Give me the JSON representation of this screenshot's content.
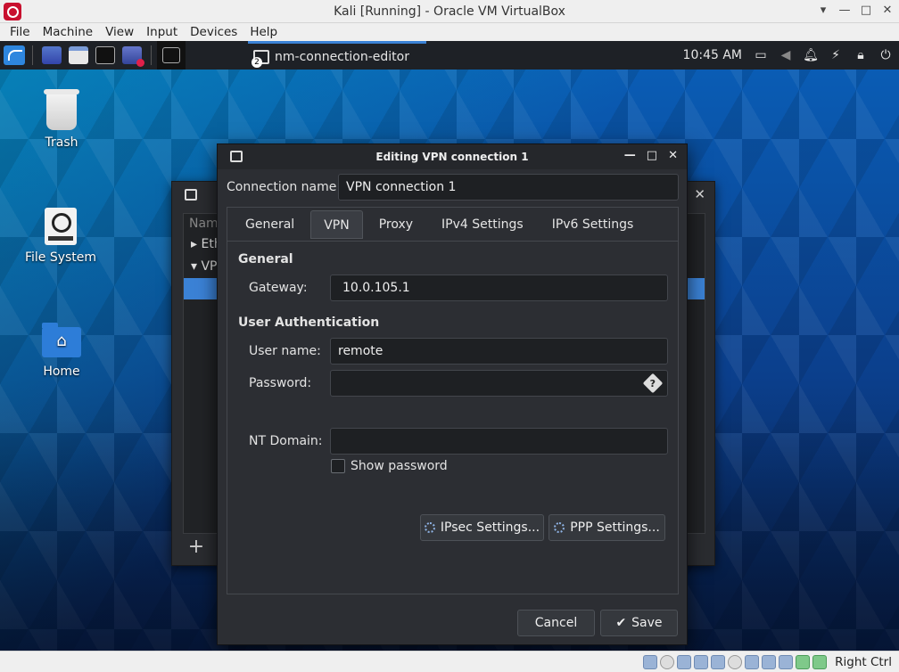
{
  "host": {
    "title": "Kali [Running] - Oracle VM VirtualBox",
    "menu": [
      "File",
      "Machine",
      "View",
      "Input",
      "Devices",
      "Help"
    ],
    "window_controls": [
      "▾",
      "—",
      "□",
      "✕"
    ],
    "status_right": "Right Ctrl"
  },
  "panel": {
    "task_label": "nm-connection-editor",
    "clock": "10:45 AM",
    "tray_icons": [
      "display-icon",
      "volume-icon",
      "bell-icon",
      "power-manager-icon",
      "lock-icon",
      "logout-icon"
    ]
  },
  "desktop": {
    "icons": [
      {
        "label": "Trash"
      },
      {
        "label": "File System"
      },
      {
        "label": "Home"
      }
    ]
  },
  "bg_window": {
    "header": "Nam",
    "rows": [
      "Eth",
      "VP"
    ]
  },
  "dialog": {
    "title": "Editing VPN connection 1",
    "connection_name_label": "Connection name",
    "connection_name_value": "VPN connection 1",
    "tabs": [
      "General",
      "VPN",
      "Proxy",
      "IPv4 Settings",
      "IPv6 Settings"
    ],
    "active_tab": "VPN",
    "general_header": "General",
    "gateway_label": "Gateway:",
    "gateway_value": "10.0.105.1",
    "auth_header": "User Authentication",
    "username_label": "User name:",
    "username_value": "remote",
    "password_label": "Password:",
    "password_value": "",
    "show_password_label": "Show password",
    "show_password_checked": false,
    "nt_domain_label": "NT Domain:",
    "nt_domain_value": "",
    "ipsec_button": "IPsec Settings...",
    "ppp_button": "PPP Settings...",
    "cancel_button": "Cancel",
    "save_button": "Save"
  },
  "colors": {
    "accent": "#3b82d6",
    "dialog_bg": "#2c2e33",
    "panel_bg": "#1e2126"
  }
}
